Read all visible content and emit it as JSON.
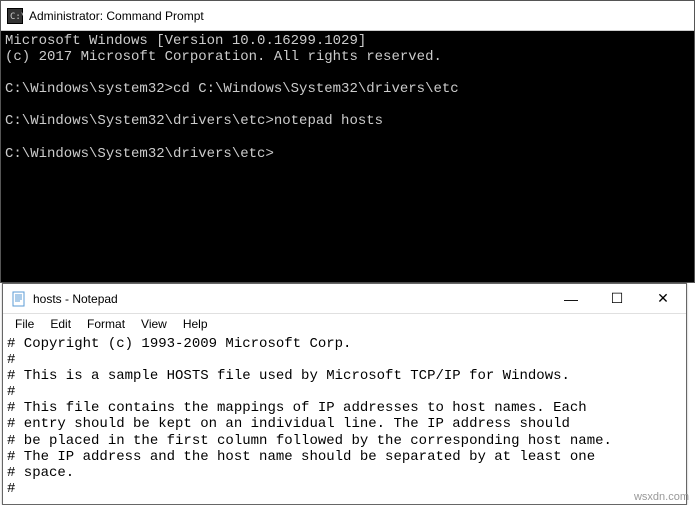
{
  "cmd": {
    "title": "Administrator: Command Prompt",
    "lines": {
      "l0": "Microsoft Windows [Version 10.0.16299.1029]",
      "l1": "(c) 2017 Microsoft Corporation. All rights reserved.",
      "l2": "",
      "l3": "C:\\Windows\\system32>cd C:\\Windows\\System32\\drivers\\etc",
      "l4": "",
      "l5": "C:\\Windows\\System32\\drivers\\etc>notepad hosts",
      "l6": "",
      "l7": "C:\\Windows\\System32\\drivers\\etc>"
    }
  },
  "notepad": {
    "title": "hosts - Notepad",
    "menu": {
      "file": "File",
      "edit": "Edit",
      "format": "Format",
      "view": "View",
      "help": "Help"
    },
    "controls": {
      "min": "—",
      "max": "☐",
      "close": "✕"
    },
    "lines": {
      "l0": "# Copyright (c) 1993-2009 Microsoft Corp.",
      "l1": "#",
      "l2": "# This is a sample HOSTS file used by Microsoft TCP/IP for Windows.",
      "l3": "#",
      "l4": "# This file contains the mappings of IP addresses to host names. Each",
      "l5": "# entry should be kept on an individual line. The IP address should",
      "l6": "# be placed in the first column followed by the corresponding host name.",
      "l7": "# The IP address and the host name should be separated by at least one",
      "l8": "# space.",
      "l9": "#"
    }
  },
  "watermark": "wsxdn.com"
}
